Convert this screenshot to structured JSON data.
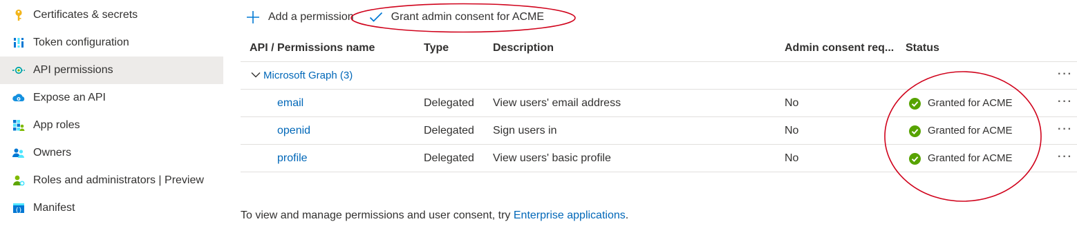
{
  "sidebar": {
    "items": [
      {
        "label": "Certificates & secrets",
        "icon": "key-icon"
      },
      {
        "label": "Token configuration",
        "icon": "token-config-icon"
      },
      {
        "label": "API permissions",
        "icon": "api-permissions-icon",
        "selected": true
      },
      {
        "label": "Expose an API",
        "icon": "cloud-api-icon"
      },
      {
        "label": "App roles",
        "icon": "app-roles-icon"
      },
      {
        "label": "Owners",
        "icon": "owners-icon"
      },
      {
        "label": "Roles and administrators | Preview",
        "icon": "roles-admin-icon"
      },
      {
        "label": "Manifest",
        "icon": "manifest-icon"
      }
    ]
  },
  "toolbar": {
    "add_label": "Add a permission",
    "grant_label": "Grant admin consent for ACME"
  },
  "table": {
    "columns": [
      "API / Permissions name",
      "Type",
      "Description",
      "Admin consent req...",
      "Status"
    ],
    "group": {
      "label": "Microsoft Graph (3)"
    },
    "more_label": "···",
    "rows": [
      {
        "name": "email",
        "type": "Delegated",
        "description": "View users' email address",
        "admin_consent": "No",
        "status": "Granted for ACME"
      },
      {
        "name": "openid",
        "type": "Delegated",
        "description": "Sign users in",
        "admin_consent": "No",
        "status": "Granted for ACME"
      },
      {
        "name": "profile",
        "type": "Delegated",
        "description": "View users' basic profile",
        "admin_consent": "No",
        "status": "Granted for ACME"
      }
    ]
  },
  "footer": {
    "text": "To view and manage permissions and user consent, try ",
    "link": "Enterprise applications",
    "suffix": "."
  },
  "colors": {
    "link": "#0067b8",
    "success": "#57a300",
    "annotation": "#d0021b",
    "selected_bg": "#edebe9"
  }
}
